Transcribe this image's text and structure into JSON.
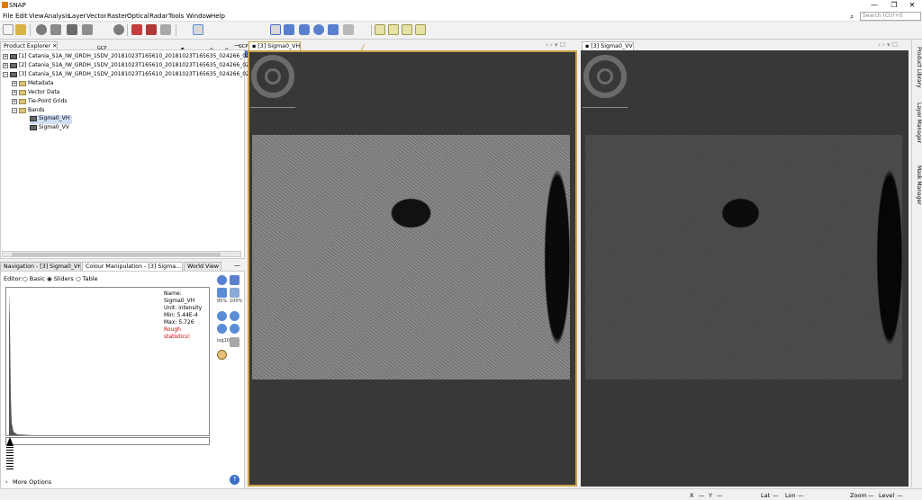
{
  "window": {
    "title": "SNAP",
    "minimize": "—",
    "maximize": "❐",
    "close": "✕"
  },
  "menu": [
    "File",
    "Edit",
    "View",
    "Analysis",
    "Layer",
    "Vector",
    "Raster",
    "Optical",
    "Radar",
    "Tools",
    "Window",
    "Help"
  ],
  "search": {
    "placeholder": "Search (Ctrl+I)"
  },
  "toolbar": {
    "gcp_label_1": "GCP",
    "gcp_label_2": "GCP"
  },
  "product_explorer": {
    "tab_label": "Product Explorer",
    "products": [
      "[1] Catania_S1A_IW_GRDH_1SDV_20181023T165610_20181023T165635_024266_02A7D4_77",
      "[2] Catania_S1A_IW_GRDH_1SDV_20181023T165610_20181023T165635_024266_02A7D4_77",
      "[3] Catania_S1A_IW_GRDH_1SDV_20181023T165610_20181023T165635_024266_02A7D4_77"
    ],
    "children": [
      "Metadata",
      "Vector Data",
      "Tie-Point Grids",
      "Bands"
    ],
    "bands": [
      "Sigma0_VH",
      "Sigma0_VV"
    ]
  },
  "bottom_panel": {
    "tabs": [
      "Navigation - [3] Sigma0_VH",
      "Colour Manipulation - [3] Sigma...",
      "World View"
    ],
    "editor_label": "Editor:",
    "editor_options": [
      "Basic",
      "Sliders",
      "Table"
    ],
    "info": {
      "name": "Name: Sigma0_VH",
      "unit": "Unit: intensity",
      "min": "Min: 5.44E-4",
      "max": "Max: 5.726",
      "rough": "Rough statistics!"
    },
    "side_labels": {
      "a": "95%",
      "b": "100%",
      "c": "log10"
    },
    "more_options": "More Options"
  },
  "image_views": [
    {
      "tab": "[3] Sigma0_VH"
    },
    {
      "tab": "[3] Sigma0_VV"
    }
  ],
  "right_strip": [
    "Product Library",
    "Layer Manager",
    "Mask Manager"
  ],
  "status": {
    "x": "X",
    "y": "Y",
    "lat": "Lat",
    "lon": "Lon",
    "zoom": "Zoom",
    "level": "Level"
  },
  "colors": {
    "selected_view_border": "#c8a04a",
    "image_bg": "#383838",
    "rough_stats": "#cc0000"
  }
}
